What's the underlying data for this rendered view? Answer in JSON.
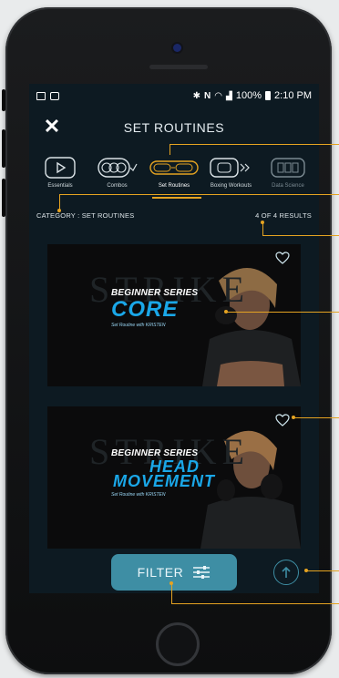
{
  "status_bar": {
    "battery": "100%",
    "time": "2:10 PM"
  },
  "header": {
    "title": "SET ROUTINES",
    "close_icon": "close-icon"
  },
  "categories": [
    {
      "label": "Essentials",
      "icon": "play-icon",
      "state": "normal"
    },
    {
      "label": "Combos",
      "icon": "combo-icon",
      "state": "normal"
    },
    {
      "label": "Set Routines",
      "icon": "set-routines-icon",
      "state": "active"
    },
    {
      "label": "Boxing Workouts",
      "icon": "boxing-workouts-icon",
      "state": "normal"
    },
    {
      "label": "Data Science",
      "icon": "data-science-icon",
      "state": "dim"
    }
  ],
  "meta": {
    "category": "CATEGORY : SET ROUTINES",
    "results": "4 OF 4 RESULTS"
  },
  "cards": [
    {
      "series": "BEGINNER SERIES",
      "title": "CORE",
      "subtitle": "Set Routine with KRISTEN",
      "watermark": "STRIKE"
    },
    {
      "series": "BEGINNER SERIES",
      "title_line1": "HEAD",
      "title_line2": "MOVEMENT",
      "subtitle": "Set Routine with KRISTEN",
      "watermark": "STRIKE"
    }
  ],
  "filter": {
    "label": "FILTER"
  },
  "colors": {
    "accent": "#e5a321",
    "brand": "#3e8ea4",
    "title_blue": "#1aa7e8",
    "background": "#0d1a22"
  }
}
